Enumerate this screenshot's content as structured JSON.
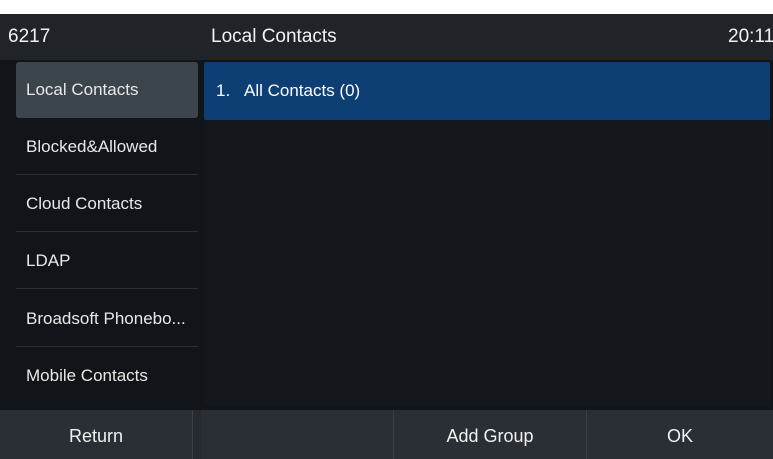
{
  "titlebar": {
    "extension": "6217",
    "title": "Local Contacts",
    "clock": "20:11"
  },
  "sidebar": {
    "items": [
      {
        "label": "Local Contacts",
        "active": true
      },
      {
        "label": "Blocked&Allowed",
        "active": false
      },
      {
        "label": "Cloud Contacts",
        "active": false
      },
      {
        "label": "LDAP",
        "active": false
      },
      {
        "label": "Broadsoft Phonebo...",
        "active": false
      },
      {
        "label": "Mobile Contacts",
        "active": false
      }
    ]
  },
  "main": {
    "rows": [
      {
        "number": "1.",
        "label": "All Contacts (0)",
        "selected": true
      }
    ]
  },
  "softkeys": {
    "key1": "Return",
    "key2": "",
    "key3": "Add Group",
    "key4": "OK"
  },
  "colors": {
    "background": "#111418",
    "titlebar": "#202327",
    "sidebar_active": "#3c444c",
    "selection": "#0e3f74",
    "softkey": "#2a2f35"
  }
}
